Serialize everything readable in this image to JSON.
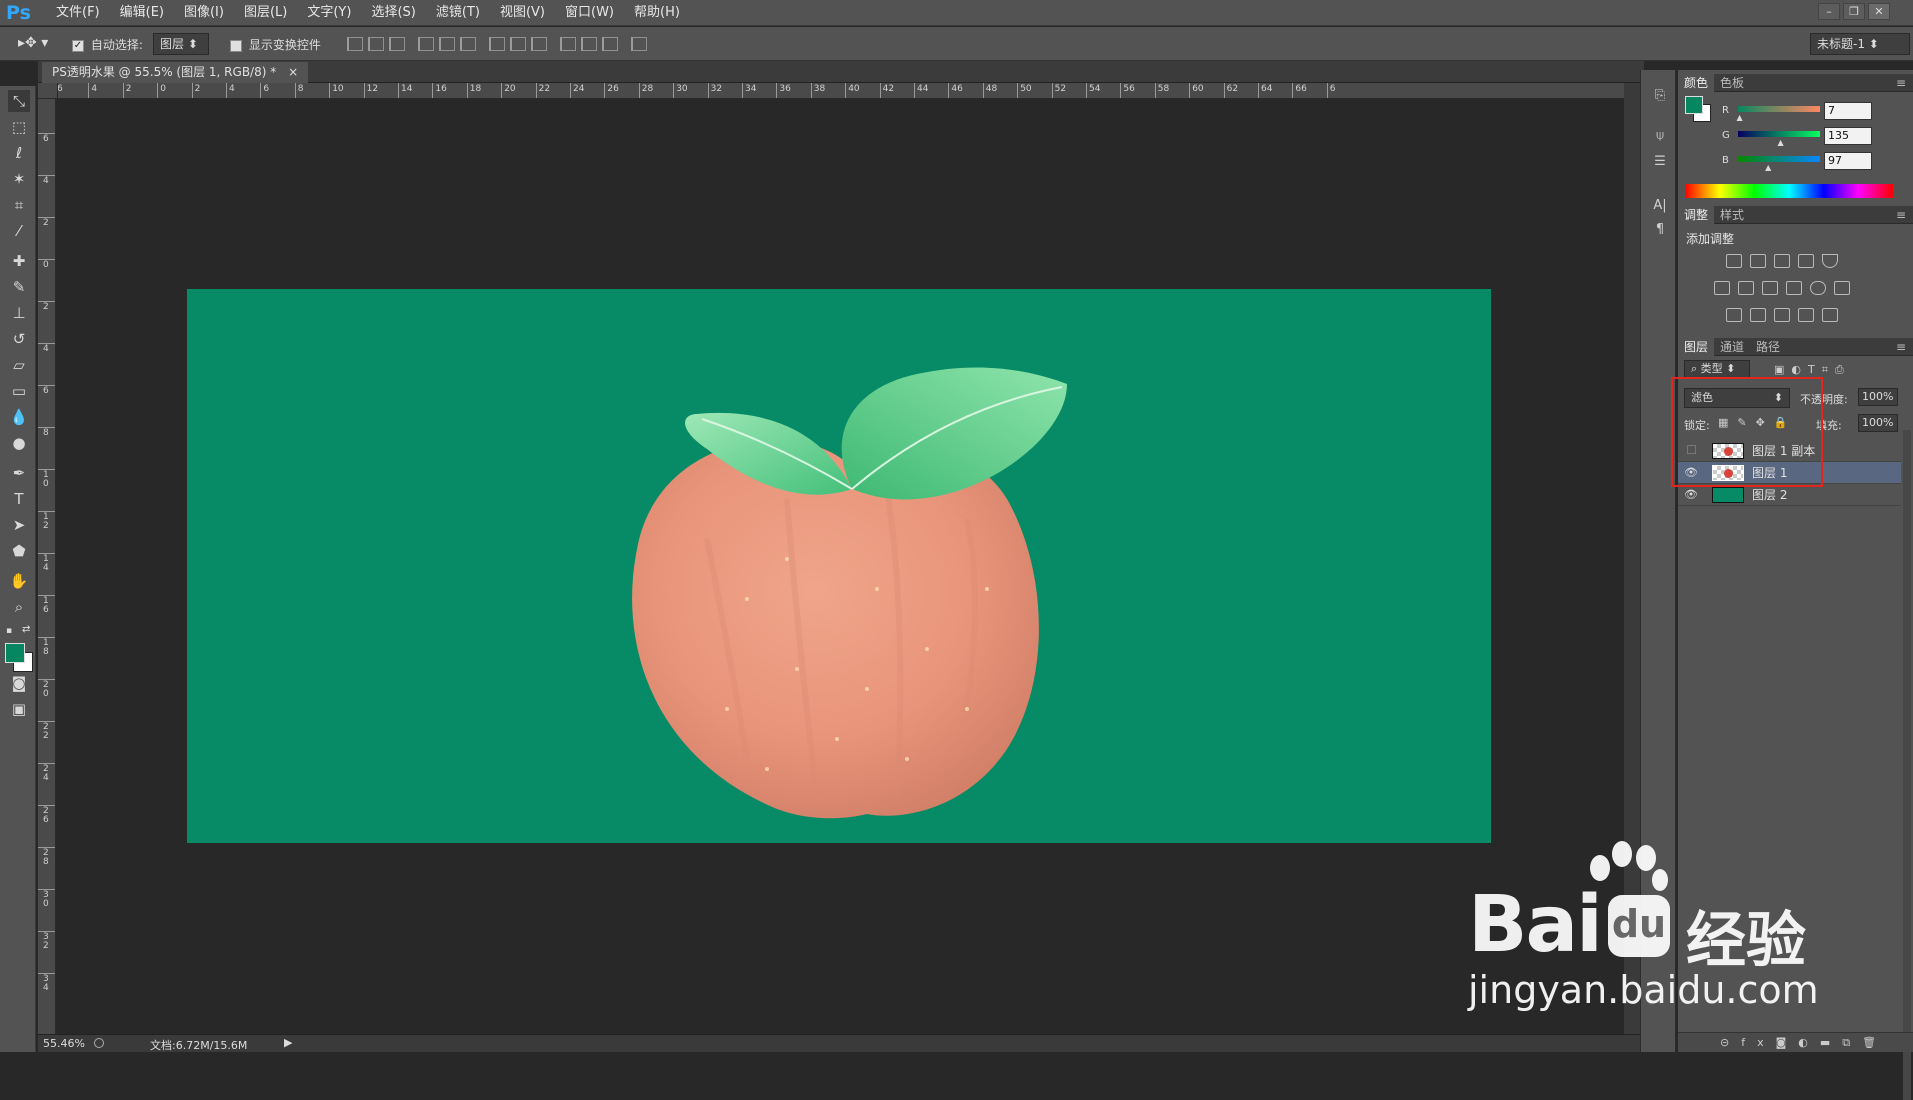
{
  "app": {
    "logo": "Ps"
  },
  "menu": [
    "文件(F)",
    "编辑(E)",
    "图像(I)",
    "图层(L)",
    "文字(Y)",
    "选择(S)",
    "滤镜(T)",
    "视图(V)",
    "窗口(W)",
    "帮助(H)"
  ],
  "options": {
    "auto_select_label": "自动选择:",
    "auto_select_value": "图层",
    "show_transform_label": "显示变换控件",
    "workspace": "未标题-1"
  },
  "document": {
    "tab_title": "PS透明水果 @ 55.5% (图层 1, RGB/8) *",
    "close": "×"
  },
  "ruler": {
    "h": [
      "6",
      "4",
      "2",
      "0",
      "2",
      "4",
      "6",
      "8",
      "10",
      "12",
      "14",
      "16",
      "18",
      "20",
      "22",
      "24",
      "26",
      "28",
      "30",
      "32",
      "34",
      "36",
      "38",
      "40",
      "42",
      "44",
      "46",
      "48",
      "50",
      "52",
      "54",
      "56",
      "58",
      "60",
      "62",
      "64",
      "66",
      "6"
    ],
    "v": [
      "8",
      "6",
      "4",
      "2",
      "0",
      "2",
      "4",
      "6",
      "8",
      "10",
      "12",
      "14",
      "16",
      "18",
      "20",
      "22",
      "24",
      "26",
      "28",
      "30",
      "32",
      "34"
    ]
  },
  "status": {
    "zoom": "55.46%",
    "doc": "文档:6.72M/15.6M"
  },
  "color_panel": {
    "tabs": [
      "颜色",
      "色板"
    ],
    "r_label": "R",
    "g_label": "G",
    "b_label": "B",
    "r": "7",
    "g": "135",
    "b": "97",
    "r_frac": 0.03,
    "g_frac": 0.53,
    "b_frac": 0.38,
    "fg_color": "#078761",
    "bg_color": "#ffffff"
  },
  "adjust_panel": {
    "tabs": [
      "调整",
      "样式"
    ],
    "title": "添加调整"
  },
  "layers_panel": {
    "tabs": [
      "图层",
      "通道",
      "路径"
    ],
    "filter": "类型",
    "blend_mode": "滤色",
    "opacity_label": "不透明度:",
    "opacity": "100%",
    "lock_label": "锁定:",
    "fill_label": "填充:",
    "fill": "100%",
    "layers": [
      {
        "name": "图层 1 副本",
        "visible": false,
        "selected": false
      },
      {
        "name": "图层 1",
        "visible": true,
        "selected": true
      },
      {
        "name": "图层 2",
        "visible": true,
        "selected": false
      }
    ]
  },
  "canvas": {
    "bg_color": "#078a66"
  },
  "watermark": {
    "brand": "Bai",
    "brand2": "经验",
    "url": "jingyan.baidu.com"
  }
}
